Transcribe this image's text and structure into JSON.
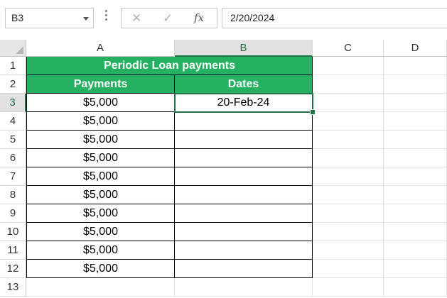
{
  "formula_bar": {
    "name_box": "B3",
    "formula": "2/20/2024",
    "cancel_icon": "x-icon",
    "enter_icon": "check-icon",
    "function_label": "fx"
  },
  "columns": [
    "A",
    "B",
    "C",
    "D"
  ],
  "rows": [
    "1",
    "2",
    "3",
    "4",
    "5",
    "6",
    "7",
    "8",
    "9",
    "10",
    "11",
    "12",
    "13"
  ],
  "table": {
    "title": "Periodic Loan payments",
    "headers": [
      "Payments",
      "Dates"
    ],
    "payments": [
      "$5,000",
      "$5,000",
      "$5,000",
      "$5,000",
      "$5,000",
      "$5,000",
      "$5,000",
      "$5,000",
      "$5,000",
      "$5,000"
    ],
    "dates": [
      "20-Feb-24",
      "",
      "",
      "",
      "",
      "",
      "",
      "",
      "",
      ""
    ]
  },
  "colors": {
    "header_fill": "#25b062",
    "selection": "#217346"
  }
}
